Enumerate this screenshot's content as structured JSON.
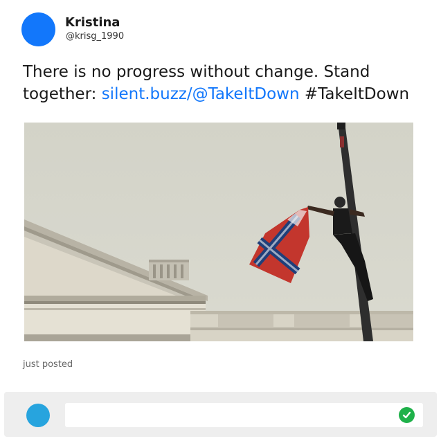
{
  "post": {
    "author_name": "Kristina",
    "author_handle": "@krisg_1990",
    "text_before_link": "There is no progress without change. Stand together: ",
    "link_text": "silent.buzz/@TakeItDown",
    "text_after_link": " #TakeItDown",
    "timestamp": "just posted"
  },
  "reply": {
    "placeholder": "",
    "value": ""
  },
  "colors": {
    "avatar": "#1277fb",
    "link": "#1277fb",
    "reply_avatar": "#27a4de",
    "submit": "#1fb14a",
    "reply_bar": "#eeeeee"
  },
  "icons": {
    "submit": "check-circle-icon"
  }
}
